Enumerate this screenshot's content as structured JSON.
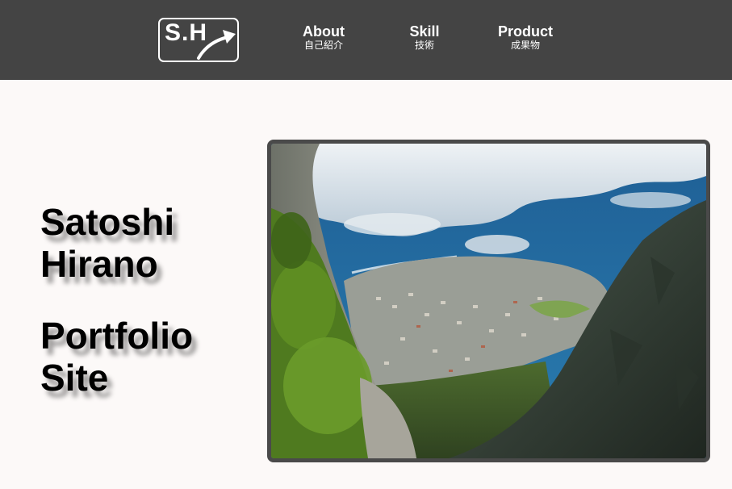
{
  "header": {
    "logo": {
      "text": "S.H",
      "icon": "arrow-up-right-icon"
    },
    "nav": [
      {
        "label": "About",
        "sublabel": "自己紹介"
      },
      {
        "label": "Skill",
        "sublabel": "技術"
      },
      {
        "label": "Product",
        "sublabel": "成果物"
      }
    ],
    "background_color": "#444444"
  },
  "hero": {
    "name_line1": "Satoshi",
    "name_line2": "Hirano",
    "site_line1": "Portfolio",
    "site_line2": "Site",
    "image": {
      "subject": "coastal town viewed from mountain cliffs",
      "icon": "landscape-photo"
    }
  },
  "colors": {
    "page_background": "#fcf9f8",
    "text": "#000000",
    "frame_border": "#4a4a4a"
  }
}
